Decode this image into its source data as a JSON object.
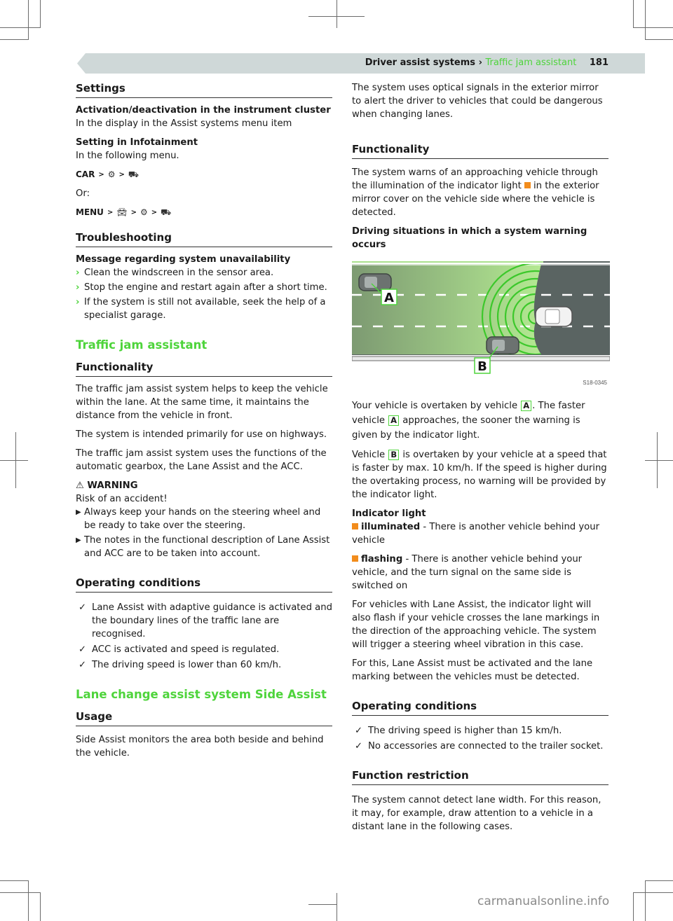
{
  "header": {
    "chapter": "Driver assist systems",
    "separator": "›",
    "section": "Traffic jam assistant",
    "page_number": "181",
    "accent_color": "#4ed43b",
    "bar_color": "#cfd8d8"
  },
  "left": {
    "settings": {
      "heading": "Settings",
      "activation_title": "Activation/deactivation in the instrument cluster",
      "activation_text": "In the display in the Assist systems menu item",
      "infotainment_title": "Setting in Infotainment",
      "infotainment_text": "In the following menu.",
      "path1": [
        "CAR",
        "settings-icon",
        "assist-systems-icon"
      ],
      "path1_label": "CAR",
      "or_text": "Or:",
      "path2_label": "MENU",
      "path_separator": ">"
    },
    "troubleshooting": {
      "heading": "Troubleshooting",
      "message_title": "Message regarding system unavailability",
      "items": [
        "Clean the windscreen in the sensor area.",
        "Stop the engine and restart again after a short time.",
        "If the system is still not available, seek the help of a specialist garage."
      ]
    },
    "traffic_jam": {
      "title": "Traffic jam assistant",
      "functionality_heading": "Functionality",
      "paragraphs": [
        "The traffic jam assist system helps to keep the vehicle within the lane. At the same time, it maintains the distance from the vehicle in front.",
        "The system is intended primarily for use on highways.",
        "The traffic jam assist system uses the functions of the automatic gearbox, the Lane Assist and the ACC."
      ],
      "warning": {
        "label": "WARNING",
        "intro": "Risk of an accident!",
        "items": [
          "Always keep your hands on the steering wheel and be ready to take over the steering.",
          "The notes in the functional description of Lane Assist and ACC are to be taken into account."
        ]
      },
      "operating_heading": "Operating conditions",
      "conditions": [
        "Lane Assist with adaptive guidance is activated and the boundary lines of the traffic lane are recognised.",
        "ACC is activated and speed is regulated.",
        "The driving speed is lower than 60 km/h."
      ]
    },
    "side_assist": {
      "title": "Lane change assist system Side Assist",
      "usage_heading": "Usage",
      "usage_text": "Side Assist monitors the area both beside and behind the vehicle."
    }
  },
  "right": {
    "intro": "The system uses optical signals in the exterior mirror to alert the driver to vehicles that could be dangerous when changing lanes.",
    "functionality_heading": "Functionality",
    "functionality_text_before": "The system warns of an approaching vehicle through the illumination of the indicator light",
    "functionality_text_after": "in the exterior mirror cover on the vehicle side where the vehicle is detected.",
    "situations_title": "Driving situations in which a system warning occurs",
    "figure": {
      "label_a": "A",
      "label_b": "B",
      "code": "S18-0345"
    },
    "p_a_1": "Your vehicle is overtaken by vehicle",
    "p_a_2": ". The faster vehicle",
    "p_a_3": "approaches, the sooner the warning is given by the indicator light.",
    "p_b_1": "Vehicle",
    "p_b_2": "is overtaken by your vehicle at a speed that is faster by max. 10 km/h. If the speed is higher during the overtaking process, no warning will be provided by the indicator light.",
    "indicator_title": "Indicator light",
    "illuminated_label": "illuminated",
    "illuminated_text": " - There is another vehicle behind your vehicle",
    "flashing_label": "flashing",
    "flashing_text": " - There is another vehicle behind your vehicle, and the turn signal on the same side is switched on",
    "lane_assist_p1": "For vehicles with Lane Assist, the indicator light will also flash if your vehicle crosses the lane markings in the direction of the approaching vehicle. The system will trigger a steering wheel vibration in this case.",
    "lane_assist_p2": "For this, Lane Assist must be activated and the lane marking between the vehicles must be detected.",
    "operating_heading": "Operating conditions",
    "conditions": [
      "The driving speed is higher than 15 km/h.",
      "No accessories are connected to the trailer socket."
    ],
    "restriction_heading": "Function restriction",
    "restriction_text": "The system cannot detect lane width. For this reason, it may, for example, draw attention to a vehicle in a distant lane in the following cases.",
    "indicator_color": "#f28c1c"
  },
  "watermark": "carmanualsonline.info"
}
